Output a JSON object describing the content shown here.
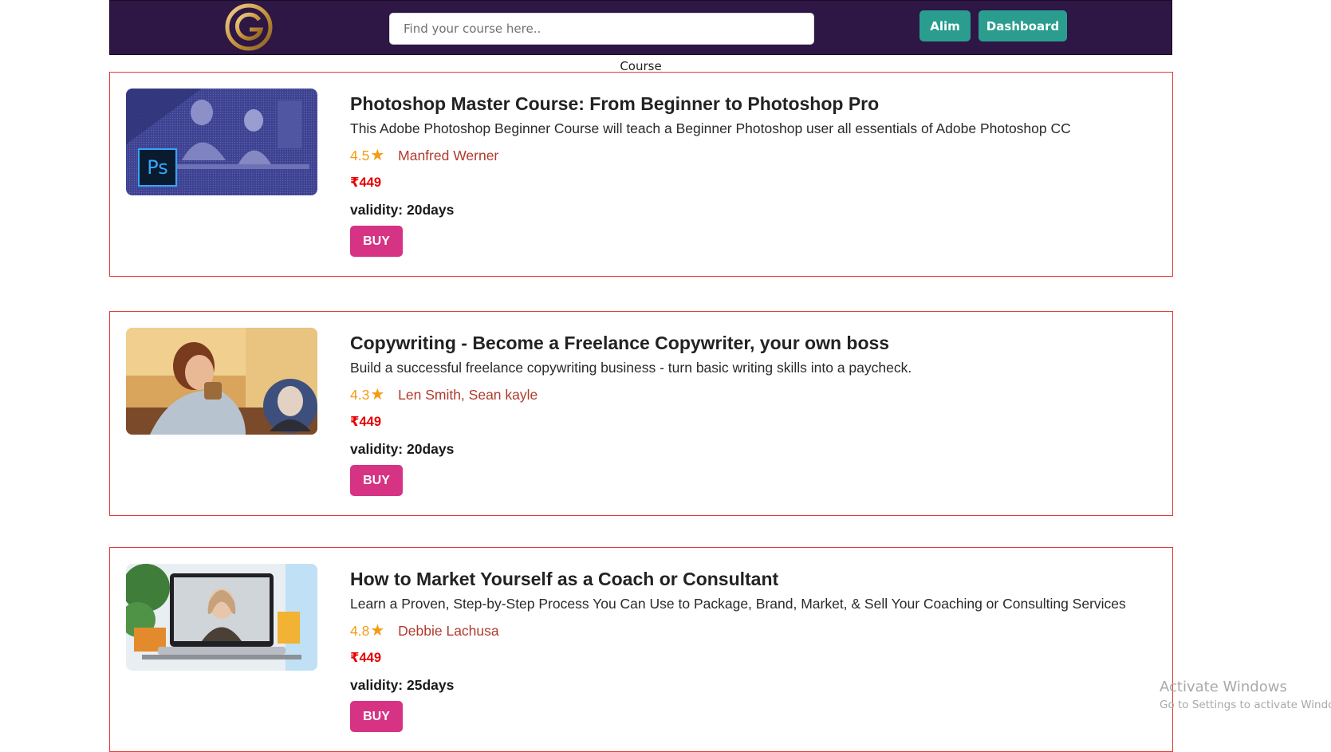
{
  "header": {
    "logo_icon": "gold-monogram-logo-icon",
    "search_placeholder": "Find your course here..",
    "user_button": "Alim",
    "dashboard_button": "Dashboard"
  },
  "page": {
    "section_title": "Course"
  },
  "courses": [
    {
      "title": "Photoshop Master Course: From Beginner to Photoshop Pro",
      "description": "This Adobe Photoshop Beginner Course will teach a Beginner Photoshop user all essentials of Adobe Photoshop CC",
      "rating": "4.5",
      "instructor": "Manfred Werner",
      "price": "₹449",
      "validity": "validity: 20days",
      "buy_label": "BUY",
      "thumb_badge": "Ps"
    },
    {
      "title": "Copywriting - Become a Freelance Copywriter, your own boss",
      "description": "Build a successful freelance copywriting business - turn basic writing skills into a paycheck.",
      "rating": "4.3",
      "instructor": "Len Smith, Sean kayle",
      "price": "₹449",
      "validity": "validity: 20days",
      "buy_label": "BUY"
    },
    {
      "title": "How to Market Yourself as a Coach or Consultant",
      "description": "Learn a Proven, Step-by-Step Process You Can Use to Package, Brand, Market, & Sell Your Coaching or Consulting Services",
      "rating": "4.8",
      "instructor": "Debbie Lachusa",
      "price": "₹449",
      "validity": "validity: 25days",
      "buy_label": "BUY"
    }
  ],
  "watermark": {
    "line1": "Activate Windows",
    "line2": "Go to Settings to activate Windows."
  },
  "colors": {
    "header_bg": "#2e1645",
    "nav_button": "#2a9d8f",
    "card_border": "#e53935",
    "buy_button": "#d63384",
    "price": "#e60000",
    "rating": "#f39c12",
    "instructor": "#b03a2e"
  }
}
